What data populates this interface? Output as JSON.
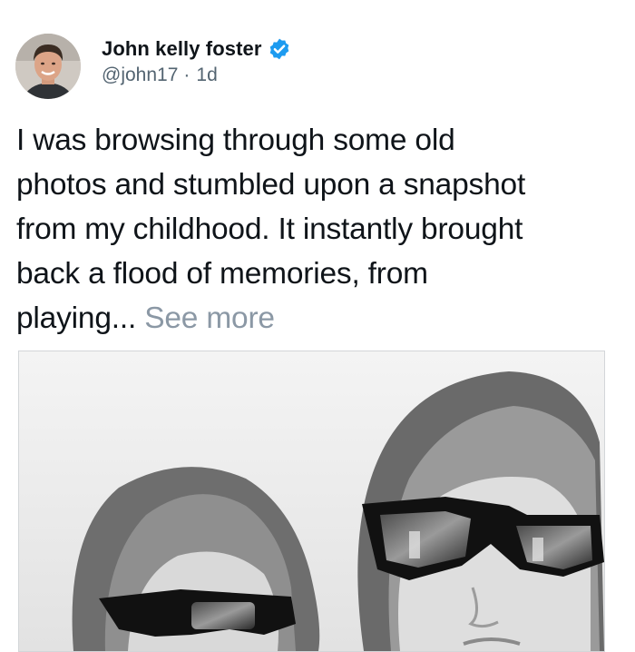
{
  "tweet": {
    "author": {
      "display_name": "John kelly foster",
      "handle": "@john17",
      "verified": true,
      "verified_icon": "verified-badge-icon",
      "badge_color": "#1d9bf0"
    },
    "separator": "·",
    "time_ago": "1d",
    "text_lines": [
      "I was browsing through some old",
      "photos and stumbled upon a snapshot",
      "from my childhood. It instantly brought",
      "back a flood of memories, from",
      "playing..."
    ],
    "see_more": "See more",
    "colors": {
      "text": "#0f1419",
      "secondary": "#536471",
      "see_more": "#8b98a5"
    }
  }
}
